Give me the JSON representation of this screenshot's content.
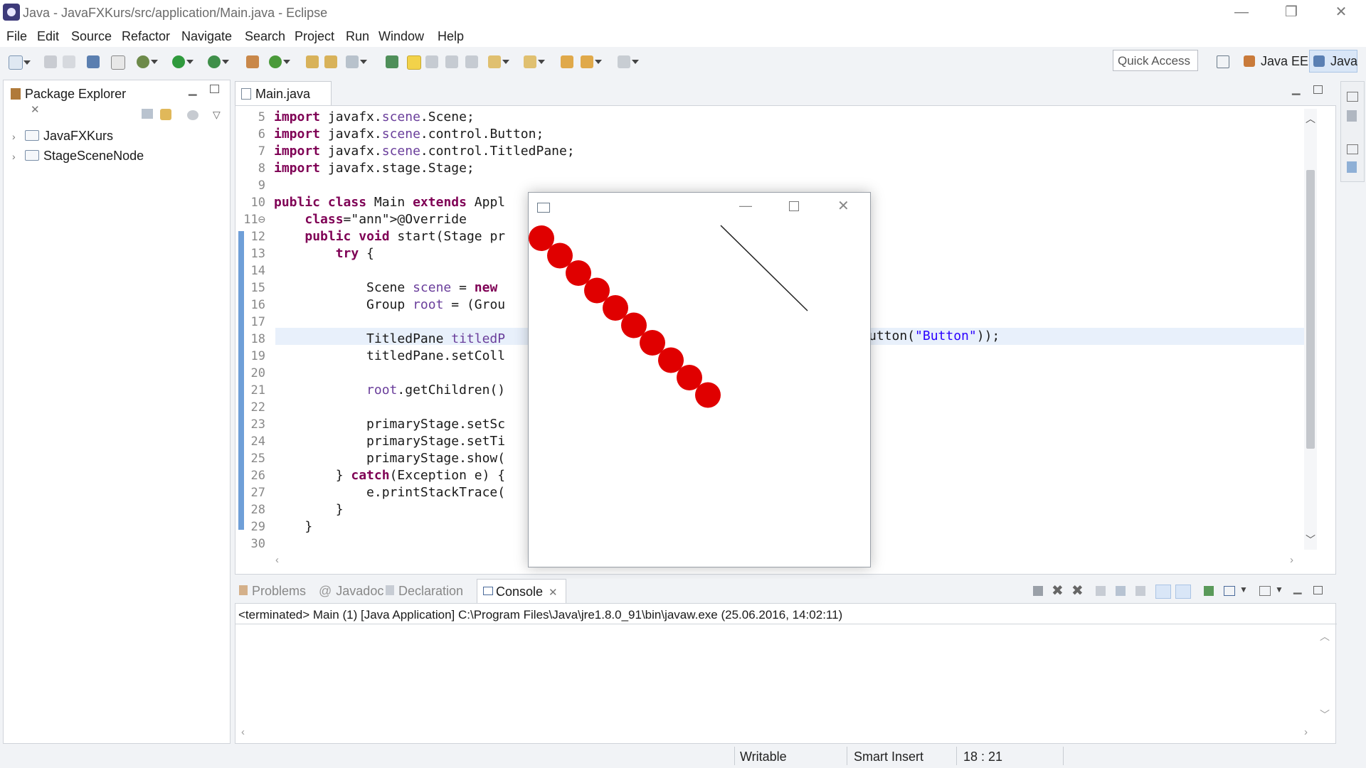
{
  "window": {
    "title": "Java - JavaFXKurs/src/application/Main.java - Eclipse",
    "minimize": "—",
    "maximize": "❐",
    "close": "✕"
  },
  "menu": [
    "File",
    "Edit",
    "Source",
    "Refactor",
    "Navigate",
    "Search",
    "Project",
    "Run",
    "Window",
    "Help"
  ],
  "toolbar": {
    "quick_access": "Quick Access",
    "perspective_javaee": "Java EE",
    "perspective_java": "Java"
  },
  "package_explorer": {
    "tab_label": "Package Explorer",
    "projects": [
      "JavaFXKurs",
      "StageSceneNode"
    ]
  },
  "editor": {
    "tab_label": "Main.java",
    "lines": [
      {
        "n": "5",
        "text": "import javafx.scene.Scene;"
      },
      {
        "n": "6",
        "text": "import javafx.scene.control.Button;"
      },
      {
        "n": "7",
        "text": "import javafx.scene.control.TitledPane;"
      },
      {
        "n": "8",
        "text": "import javafx.stage.Stage;"
      },
      {
        "n": "9",
        "text": ""
      },
      {
        "n": "10",
        "text": "public class Main extends Appl"
      },
      {
        "n": "11⊖",
        "text": "    @Override"
      },
      {
        "n": "12",
        "text": "    public void start(Stage pr"
      },
      {
        "n": "13",
        "text": "        try {"
      },
      {
        "n": "14",
        "text": ""
      },
      {
        "n": "15",
        "text": "            Scene scene = new"
      },
      {
        "n": "16",
        "text": "            Group root = (Grou"
      },
      {
        "n": "17",
        "text": ""
      },
      {
        "n": "18",
        "text": "            TitledPane titledP"
      },
      {
        "n": "19",
        "text": "            titledPane.setColl"
      },
      {
        "n": "20",
        "text": ""
      },
      {
        "n": "21",
        "text": "            root.getChildren()"
      },
      {
        "n": "22",
        "text": ""
      },
      {
        "n": "23",
        "text": "            primaryStage.setSc"
      },
      {
        "n": "24",
        "text": "            primaryStage.setTi"
      },
      {
        "n": "25",
        "text": "            primaryStage.show("
      },
      {
        "n": "26",
        "text": "        } catch(Exception e) {"
      },
      {
        "n": "27",
        "text": "            e.printStackTrace("
      },
      {
        "n": "28",
        "text": "        }"
      },
      {
        "n": "29",
        "text": "    }"
      },
      {
        "n": "30",
        "text": ""
      }
    ],
    "line18_tail": "utton(\"Button\"));"
  },
  "bottom_tabs": {
    "problems": "Problems",
    "javadoc": "Javadoc",
    "declaration": "Declaration",
    "console": "Console"
  },
  "console": {
    "header": "<terminated> Main (1) [Java Application] C:\\Program Files\\Java\\jre1.8.0_91\\bin\\javaw.exe (25.06.2016, 14:02:11)"
  },
  "status": {
    "writable": "Writable",
    "insert_mode": "Smart Insert",
    "position": "18 : 21"
  },
  "colors": {
    "keyword": "#7f0055",
    "string": "#2a00ff",
    "circle_fill": "#e00000",
    "selection": "#d9e6f7"
  }
}
